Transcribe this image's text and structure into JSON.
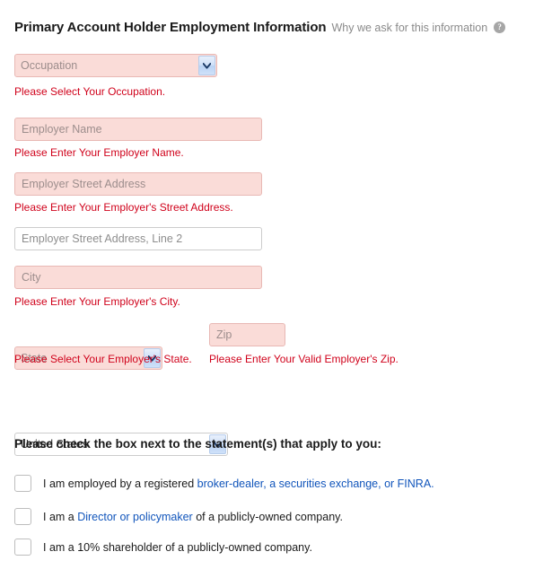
{
  "header": {
    "title": "Primary Account Holder Employment Information",
    "subtitle": "Why we ask for this information",
    "help_icon": "help-circle-icon",
    "help_glyph": "?"
  },
  "colors": {
    "error_text": "#d0021b",
    "error_field_bg": "#fadcd8",
    "error_field_border": "#e8b8b4",
    "link": "#1155bb",
    "subtitle": "#8a8a8a",
    "page_bg": "#ffffff"
  },
  "form": {
    "occupation": {
      "value": "Occupation",
      "is_placeholder": true,
      "error": "Please Select Your Occupation.",
      "arrow_icon": "chevron-down-icon"
    },
    "employer_name": {
      "placeholder": "Employer Name",
      "value": "",
      "error": "Please Enter Your Employer Name."
    },
    "employer_street_address": {
      "placeholder": "Employer Street Address",
      "value": "",
      "error": "Please Enter Your Employer's Street Address."
    },
    "employer_street_address_2": {
      "placeholder": "Employer Street Address, Line 2",
      "value": "",
      "error": ""
    },
    "city": {
      "placeholder": "City",
      "value": "",
      "error": "Please Enter Your Employer's City."
    },
    "state": {
      "value": "State",
      "is_placeholder": true,
      "error": "Please Select Your Employer's State.",
      "arrow_icon": "chevron-down-icon"
    },
    "zip": {
      "placeholder": "Zip",
      "value": "",
      "error": "Please Enter Your Valid Employer's Zip."
    },
    "country": {
      "value": "United States",
      "is_placeholder": false,
      "error": "",
      "arrow_icon": "chevron-down-icon"
    }
  },
  "affiliations": {
    "heading": "Please check the box next to the statement(s) that apply to you:",
    "items": [
      {
        "checked": false,
        "text_before": "I am employed by a registered ",
        "link_text": "broker-dealer, a securities exchange, or FINRA.",
        "text_after": ""
      },
      {
        "checked": false,
        "text_before": "I am a ",
        "link_text": "Director or policymaker",
        "text_after": " of a publicly-owned company."
      },
      {
        "checked": false,
        "text_before": "I am a 10% shareholder of a publicly-owned company.",
        "link_text": "",
        "text_after": ""
      }
    ]
  }
}
